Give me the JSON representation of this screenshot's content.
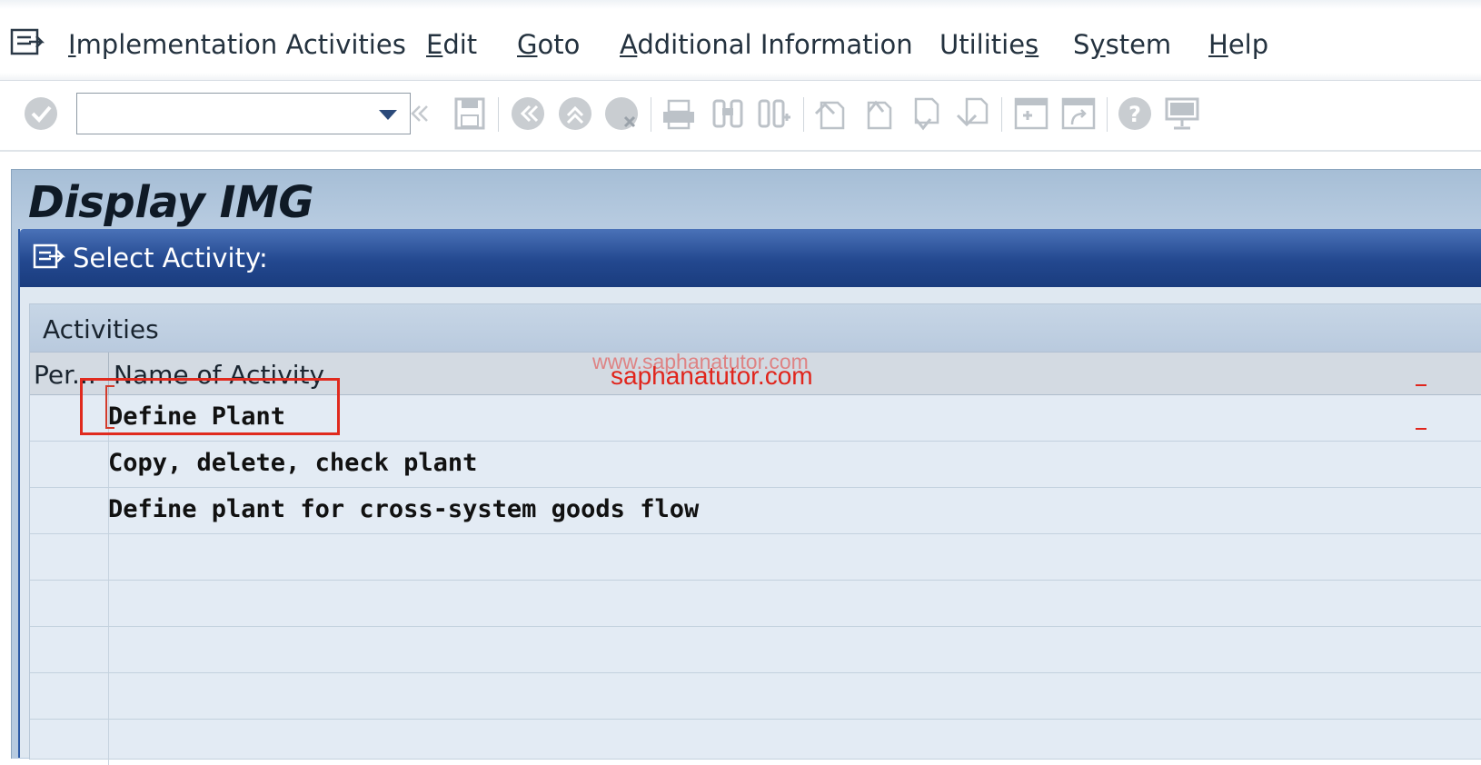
{
  "menubar": {
    "items": [
      {
        "pre": "",
        "ul": "I",
        "post": "mplementation Activities"
      },
      {
        "pre": "",
        "ul": "E",
        "post": "dit"
      },
      {
        "pre": "",
        "ul": "G",
        "post": "oto"
      },
      {
        "pre": "",
        "ul": "A",
        "post": "dditional Information"
      },
      {
        "pre": "Utilitie",
        "ul": "s",
        "post": ""
      },
      {
        "pre": "S",
        "ul": "y",
        "post": "stem"
      },
      {
        "pre": "",
        "ul": "H",
        "post": "elp"
      }
    ]
  },
  "toolbar": {
    "command_field_value": "",
    "icons": [
      "enter-icon",
      "command-dropdown-icon",
      "back-double-chevron-icon",
      "save-icon",
      "back-icon",
      "exit-icon",
      "cancel-icon",
      "print-icon",
      "find-icon",
      "find-next-icon",
      "first-page-icon",
      "previous-page-icon",
      "next-page-icon",
      "last-page-icon",
      "create-session-icon",
      "shortcut-icon",
      "help-icon",
      "customize-layout-icon"
    ]
  },
  "main": {
    "title": "Display IMG"
  },
  "dialog": {
    "title": "Select Activity:",
    "panel_title": "Activities",
    "columns": [
      "Per...",
      "Name of Activity"
    ],
    "rows": [
      "Define Plant",
      "Copy, delete, check plant",
      "Define plant for cross-system goods flow"
    ],
    "highlight_color": "#e02a1e"
  },
  "watermark": {
    "line1": "www.saphanatutor.com",
    "line2": "saphanatutor.com"
  }
}
